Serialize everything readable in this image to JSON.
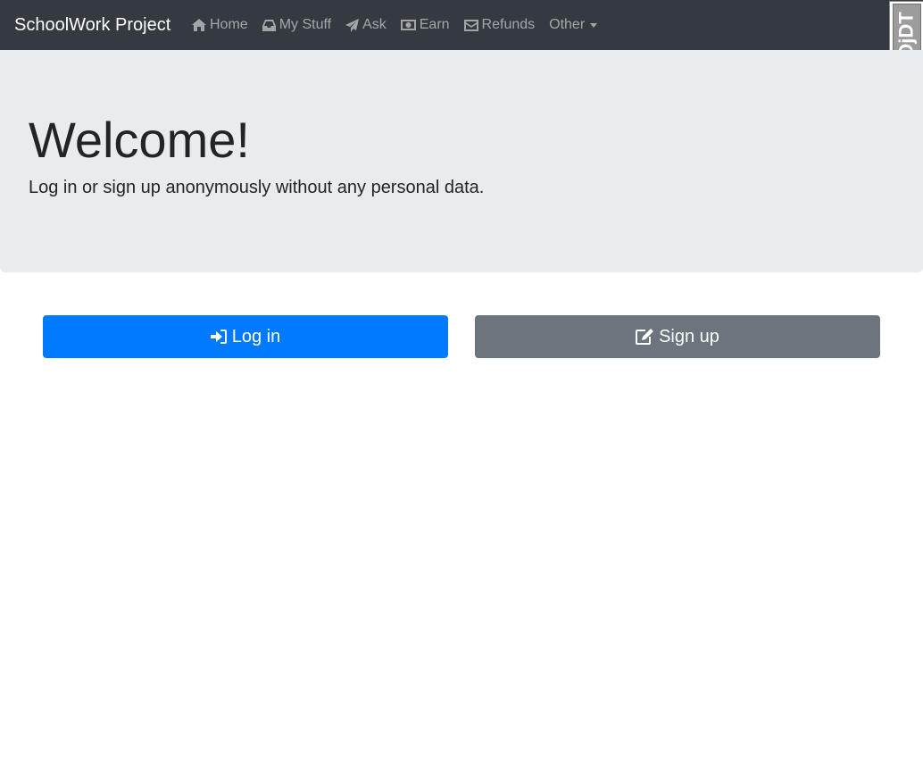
{
  "navbar": {
    "brand": "SchoolWork Project",
    "items": [
      {
        "label": "Home",
        "icon": "home-icon"
      },
      {
        "label": "My Stuff",
        "icon": "inbox-icon"
      },
      {
        "label": "Ask",
        "icon": "paper-plane-icon"
      },
      {
        "label": "Earn",
        "icon": "money-icon"
      },
      {
        "label": "Refunds",
        "icon": "envelope-icon"
      },
      {
        "label": "Other",
        "icon": "dropdown-caret"
      }
    ]
  },
  "debug_toolbar": {
    "label": "DjDT"
  },
  "hero": {
    "title": "Welcome!",
    "lead": "Log in or sign up anonymously without any personal data."
  },
  "actions": {
    "login_label": "Log in",
    "signup_label": "Sign up"
  },
  "colors": {
    "navbar_bg": "#343a40",
    "jumbotron_bg": "#e9ecef",
    "primary": "#007bff",
    "secondary": "#6c757d"
  }
}
